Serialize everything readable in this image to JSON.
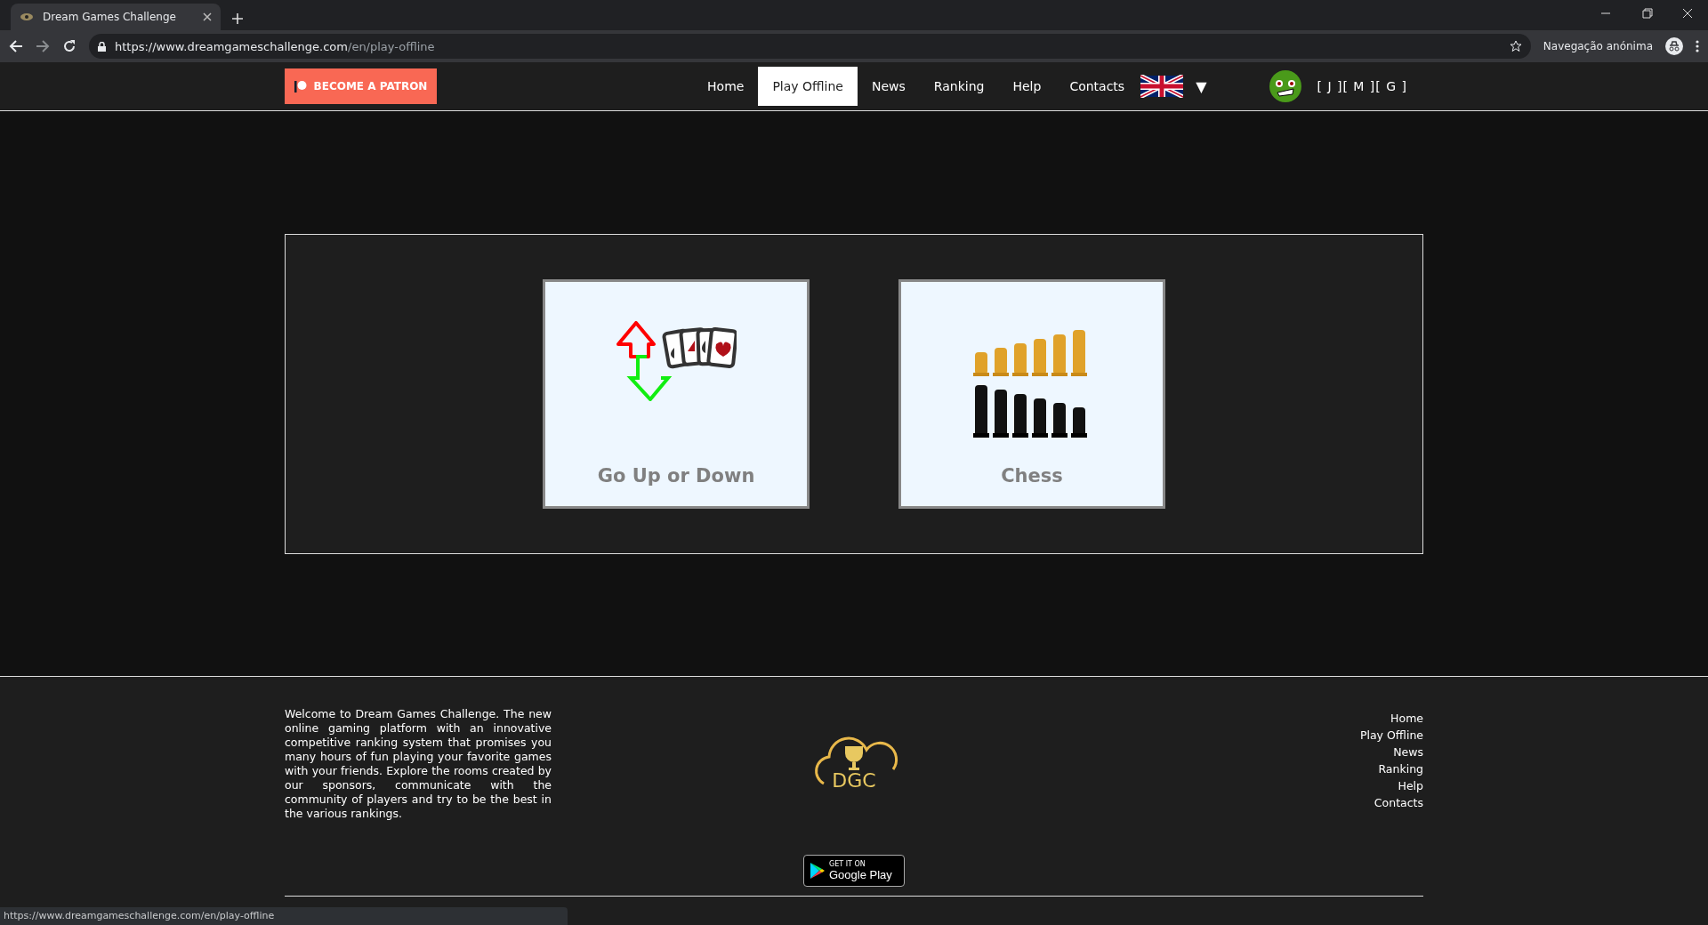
{
  "browser": {
    "tab_title": "Dream Games Challenge",
    "url_host": "https://www.dreamgameschallenge.com",
    "url_path": "/en/play-offline",
    "incognito_label": "Navegação anónima"
  },
  "header": {
    "patron_button": "BECOME A PATRON",
    "nav": [
      {
        "label": "Home",
        "selected": false
      },
      {
        "label": "Play Offline",
        "selected": true
      },
      {
        "label": "News",
        "selected": false
      },
      {
        "label": "Ranking",
        "selected": false
      },
      {
        "label": "Help",
        "selected": false
      },
      {
        "label": "Contacts",
        "selected": false
      }
    ],
    "language_caret": "▼",
    "user_tag": "[ J ][ M ][ G ]"
  },
  "games": [
    {
      "title": "Go Up or Down",
      "kind": "cards"
    },
    {
      "title": "Chess",
      "kind": "chess"
    }
  ],
  "footer": {
    "about": "Welcome to Dream Games Challenge. The new online gaming platform with an innovative competitive ranking system that promises you many hours of fun playing your favorite games with your friends. Explore the rooms created by our sponsors, communicate with the community of players and try to be the best in the various rankings.",
    "logo_text": "DGC",
    "badge_small": "GET IT ON",
    "badge_large": "Google Play",
    "links": [
      "Home",
      "Play Offline",
      "News",
      "Ranking",
      "Help",
      "Contacts"
    ]
  },
  "status_url": "https://www.dreamgameschallenge.com/en/play-offline"
}
